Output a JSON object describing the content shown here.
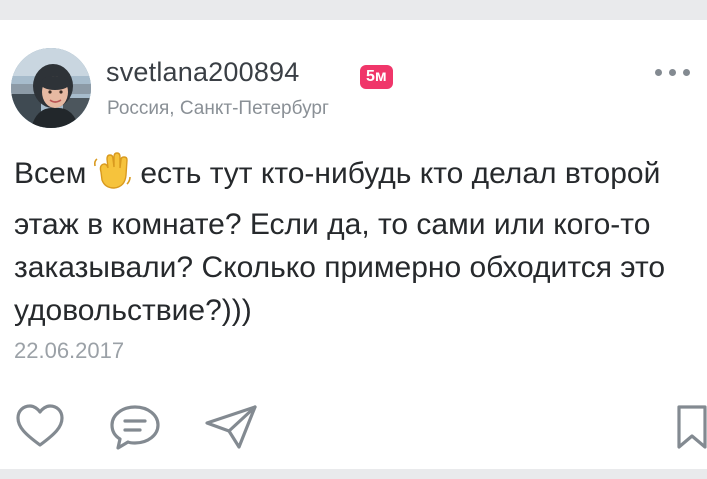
{
  "post": {
    "username": "svetlana200894",
    "time_badge": "5м",
    "location": "Россия, Санкт-Петербург",
    "text_before_emoji": "Всем",
    "text_after_emoji": "есть тут кто-нибудь кто делал второй этаж в комнате? Если да, то сами или кого-то заказывали? Сколько примерно обходится это удовольствие?)))",
    "emoji": "waving-hand-icon",
    "date": "22.06.2017"
  },
  "icons": {
    "more": "more-horizontal-icon",
    "like": "heart-icon",
    "comment": "comment-bubble-icon",
    "share": "paper-plane-icon",
    "save": "bookmark-icon"
  },
  "colors": {
    "badge": "#f0366a",
    "text": "#26292c",
    "muted": "#8a9096",
    "icon": "#838a91"
  }
}
